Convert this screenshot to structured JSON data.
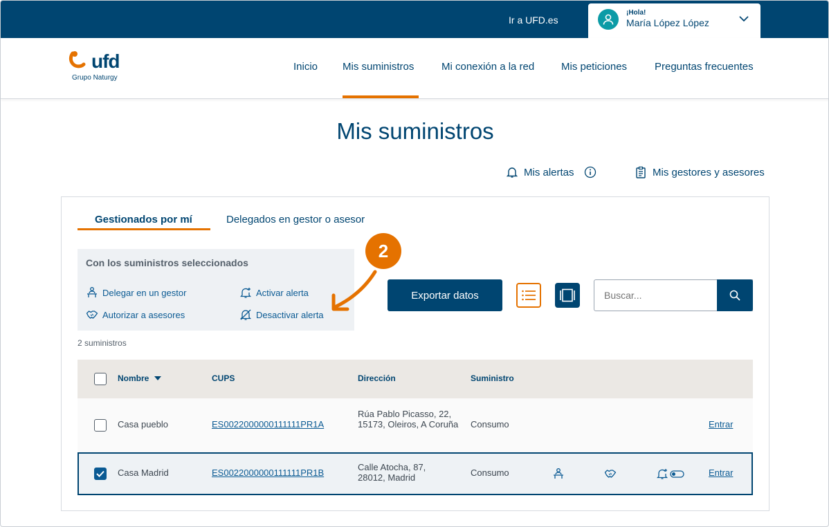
{
  "topbar": {
    "ir_link": "Ir a UFD.es",
    "greeting": "¡Hola!",
    "user_name": "María López López"
  },
  "logo": {
    "text": "ufd",
    "sub": "Grupo Naturgy"
  },
  "nav": {
    "items": [
      {
        "label": "Inicio"
      },
      {
        "label": "Mis suministros"
      },
      {
        "label": "Mi conexión a la red"
      },
      {
        "label": "Mis peticiones"
      },
      {
        "label": "Preguntas frecuentes"
      }
    ],
    "active": "Mis suministros"
  },
  "page_title": "Mis suministros",
  "quick_links": {
    "alertas": "Mis alertas",
    "gestores": "Mis gestores y asesores"
  },
  "tabs": {
    "gestionados": "Gestionados por mí",
    "delegados": "Delegados en gestor o asesor"
  },
  "actions": {
    "title": "Con los suministros seleccionados",
    "delegar": "Delegar en un gestor",
    "autorizar": "Autorizar a asesores",
    "activar": "Activar alerta",
    "desactivar": "Desactivar alerta"
  },
  "badge": "2",
  "toolbar": {
    "export_label": "Exportar datos",
    "search_placeholder": "Buscar..."
  },
  "count_text": "2 suministros",
  "table": {
    "headers": {
      "nombre": "Nombre",
      "cups": "CUPS",
      "direccion": "Dirección",
      "suministro": "Suministro"
    },
    "rows": [
      {
        "nombre": "Casa pueblo",
        "cups": "ES0022000000111111PR1A",
        "direccion": "Rúa Pablo Picasso, 22, 15173, Oleiros, A Coruña",
        "suministro": "Consumo",
        "entrar": "Entrar",
        "checked": false
      },
      {
        "nombre": "Casa Madrid",
        "cups": "ES0022000000111111PR1B",
        "direccion": "Calle Atocha, 87, 28012, Madrid",
        "suministro": "Consumo",
        "entrar": "Entrar",
        "checked": true
      }
    ]
  },
  "colors": {
    "primary": "#004571",
    "accent": "#e57200",
    "link": "#0a5a93",
    "avatar": "#0c9ba6"
  }
}
